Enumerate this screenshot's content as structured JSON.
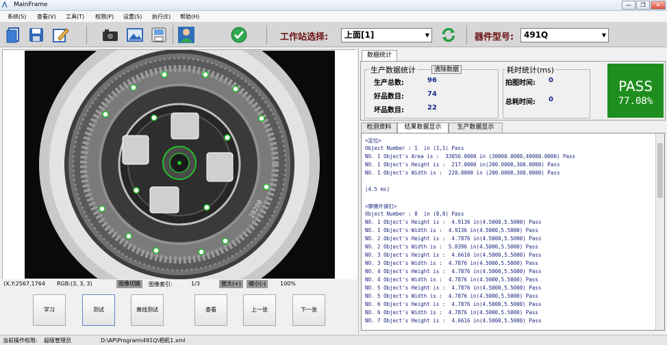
{
  "window": {
    "title": "MainFrame",
    "buttons": [
      "—",
      "❐",
      "✕"
    ]
  },
  "menu": [
    "系统(S)",
    "查看(V)",
    "工具(T)",
    "权限(P)",
    "设置(S)",
    "执行(E)",
    "帮助(H)"
  ],
  "toolbar": {
    "workstation_label": "工作站选择:",
    "workstation_value": "上面[1]",
    "device_label": "器件型号:",
    "device_value": "491Q"
  },
  "image_status": {
    "coords": "(X,Y:2567,1764",
    "rgb": "RGB:(3, 3, 3)",
    "switch_btn": "图像切换",
    "index_label": "图像索引:",
    "index_value": "1/3",
    "zoom_in": "放大(+)",
    "zoom_out": "缩小(-)",
    "zoom": "100%"
  },
  "action_buttons": [
    "学习",
    "测试",
    "离线测试",
    "查看",
    "上一张",
    "下一张"
  ],
  "stats": {
    "tab": "数据统计",
    "prod_title": "生产数据统计",
    "clear_btn": "清除数据",
    "total_label": "生产总数:",
    "total_value": "96",
    "good_label": "好品数目:",
    "good_value": "74",
    "bad_label": "坏品数目:",
    "bad_value": "22",
    "time_title": "耗时统计(ms)",
    "capture_label": "拍图时间:",
    "capture_value": "0",
    "total_time_label": "总耗时间:",
    "total_time_value": "0",
    "pass_text": "PASS",
    "pass_rate": "77.08%"
  },
  "subtabs": [
    "检测资料",
    "结果数据显示",
    "生产数据显示"
  ],
  "log_lines": [
    "<定位>",
    "Object Number : 1  in (1,1) Pass",
    "NO. 1 Object's Area is :  33056.0000 in (30000.0000,40000.0000) Pass",
    "NO. 1 Object's Height is :  217.0000 in(200.0000,300.0000) Pass",
    "NO. 1 Object's Width is :  220.0000 in (200.0000,300.0000) Pass",
    "",
    "(4.5 ms)",
    "",
    "<摩擦片铆钉>",
    "Object Number : 8  in (8,8) Pass",
    "NO. 1 Object's Height is :  4.9136 in(4.5000,5.5000) Pass",
    "NO. 1 Object's Width is :  4.9136 in(4.5000,5.5000) Pass",
    "NO. 2 Object's Height is :  4.7876 in(4.5000,5.5000) Pass",
    "NO. 2 Object's Width is :  5.0396 in(4.5000,5.5000) Pass",
    "NO. 3 Object's Height is :  4.6616 in(4.5000,5.5000) Pass",
    "NO. 3 Object's Width is :  4.7876 in(4.5000,5.5000) Pass",
    "NO. 4 Object's Height is :  4.7876 in(4.5000,5.5000) Pass",
    "NO. 4 Object's Width is :  4.7876 in(4.5000,5.5000) Pass",
    "NO. 5 Object's Height is :  4.7876 in(4.5000,5.5000) Pass",
    "NO. 5 Object's Width is :  4.7876 in(4.5000,5.5000) Pass",
    "NO. 6 Object's Height is :  4.7876 in(4.5000,5.5000) Pass",
    "NO. 6 Object's Width is :  4.7876 in(4.5000,5.5000) Pass",
    "NO. 7 Object's Height is :  4.6616 in(4.5000,5.5000) Pass"
  ],
  "statusbar": {
    "perm_label": "当前操作权限:",
    "perm_value": "超级管理员",
    "path": "D:\\AP\\Program\\491Q\\相机1.xml"
  },
  "colors": {
    "pass_green": "#1e8f1e",
    "log_text": "#1a237e",
    "label_red": "#6b1010"
  }
}
